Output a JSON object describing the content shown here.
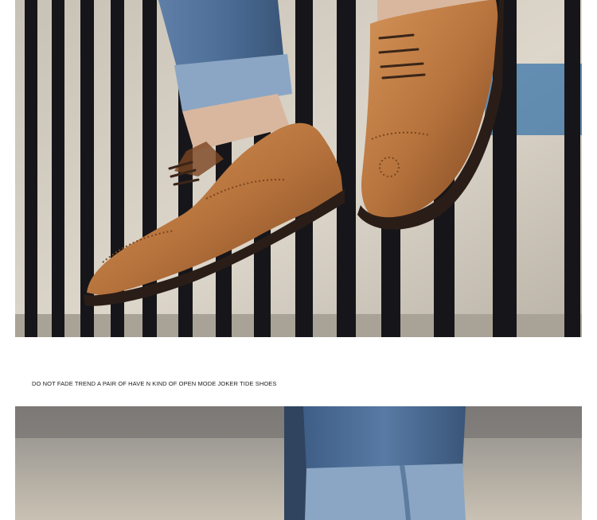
{
  "caption": "DO NOT FADE TREND A PAIR OF HAVE N KIND OF OPEN MODE JOKER TIDE SHOES",
  "colors": {
    "shoe_leather": "#b8743d",
    "shoe_shadow": "#7a4521",
    "sole": "#2a1d17",
    "denim": "#4d6e97",
    "cuff": "#8aa6c4",
    "fence": "#16161a",
    "background": "#d7d0c4"
  }
}
